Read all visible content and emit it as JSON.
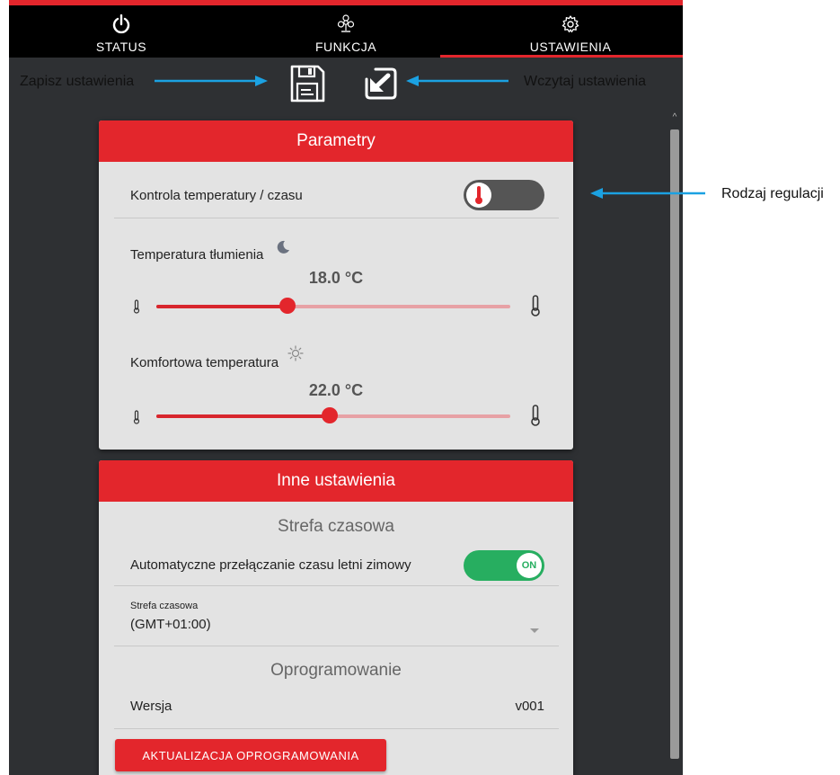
{
  "nav": {
    "tabs": [
      {
        "label": "STATUS",
        "icon": "power-icon"
      },
      {
        "label": "FUNKCJA",
        "icon": "fan-icon"
      },
      {
        "label": "USTAWIENIA",
        "icon": "gear-icon"
      }
    ],
    "active_tab": "USTAWIENIA"
  },
  "toolbar": {
    "save_icon": "floppy-disk-icon",
    "load_icon": "load-arrow-icon"
  },
  "annotations": {
    "save": "Zapisz ustawienia",
    "load": "Wczytaj ustawienia",
    "regulation": "Rodzaj regulacji"
  },
  "parametry": {
    "title": "Parametry",
    "control_label": "Kontrola temperatury / czasu",
    "control_toggle_icon": "thermometer-icon",
    "damping": {
      "label": "Temperatura tłumienia",
      "icon": "moon-icon",
      "value": "18.0 °C",
      "fraction": 0.37
    },
    "comfort": {
      "label": "Komfortowa temperatura",
      "icon": "sun-icon",
      "value": "22.0 °C",
      "fraction": 0.49
    }
  },
  "inne": {
    "title": "Inne ustawienia",
    "timezone_section": "Strefa czasowa",
    "auto_dst_label": "Automatyczne przełączanie czasu letni zimowy",
    "auto_dst_toggle": "ON",
    "timezone_field_label": "Strefa czasowa",
    "timezone_value": "(GMT+01:00)",
    "firmware_section": "Oprogramowanie",
    "version_label": "Wersja",
    "version_value": "v001",
    "update_button": "AKTUALIZACJA OPROGRAMOWANIA"
  },
  "colors": {
    "accent": "#e3262c",
    "toggle_on": "#27ae60",
    "toggle_off": "#555555",
    "background": "#2e3033",
    "card": "#e3e3e3"
  }
}
